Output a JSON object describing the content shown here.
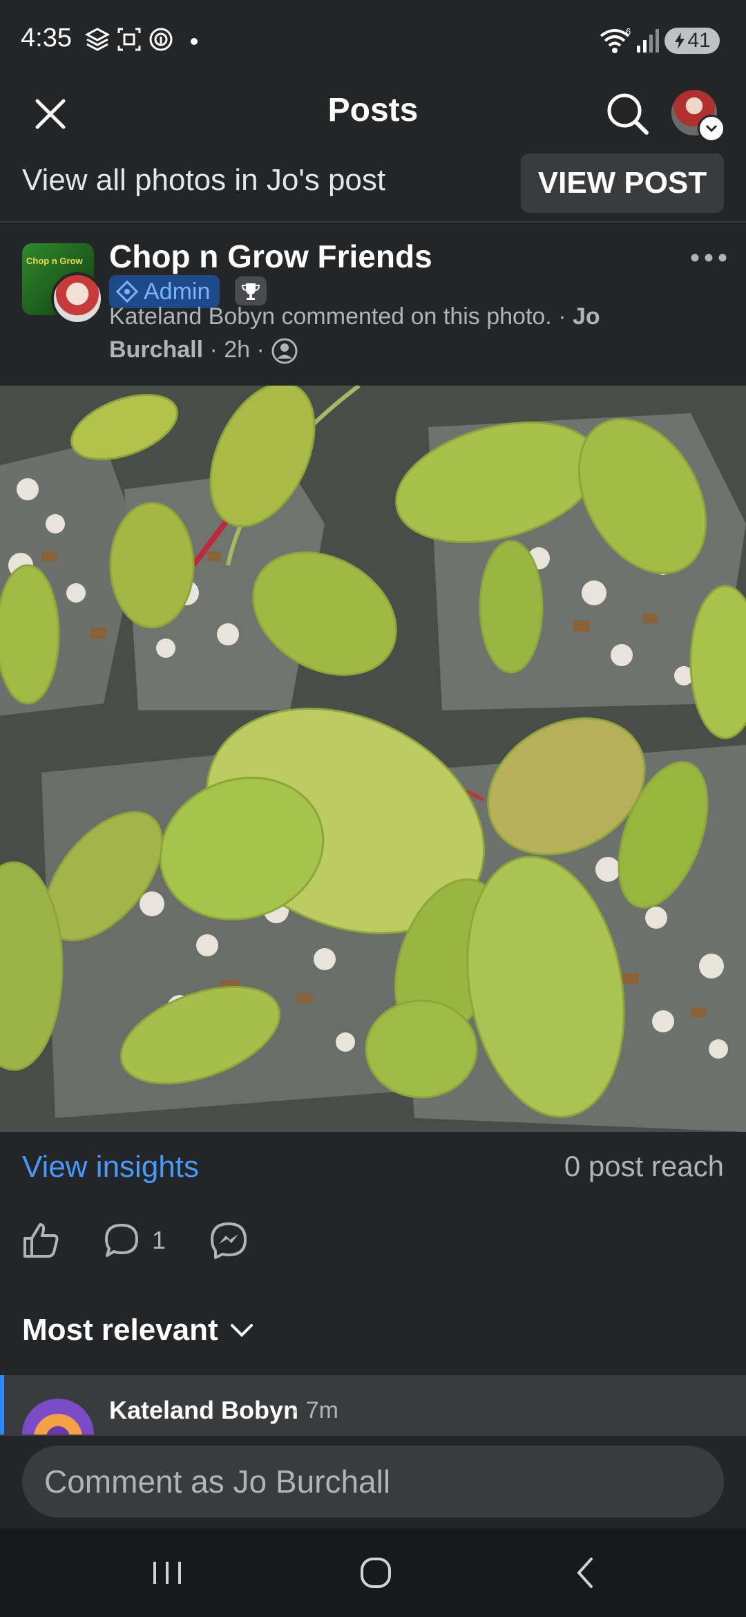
{
  "status_bar": {
    "time": "4:35",
    "battery": "41",
    "icons": [
      "stack-icon",
      "screenshot-icon",
      "nfc-icon",
      "dot-icon",
      "wifi-icon",
      "signal-icon",
      "charging-icon"
    ]
  },
  "header": {
    "title": "Posts",
    "close_icon": "close-icon",
    "search_icon": "search-icon"
  },
  "view_all": {
    "text": "View all photos in Jo's post",
    "button": "VIEW POST"
  },
  "post": {
    "group_name": "Chop n Grow Friends",
    "group_logo_text": "Chop n Grow",
    "admin_label": "Admin",
    "meta_text": "Kateland Bobyn commented on this photo. · ",
    "author": "Jo Burchall",
    "time": " · 2h · "
  },
  "insights": {
    "link": "View insights",
    "reach": "0 post reach"
  },
  "actions": {
    "comment_count": "1"
  },
  "comments": {
    "sort_label": "Most relevant",
    "first": {
      "name": "Kateland Bobyn",
      "time": "· 7m"
    }
  },
  "composer": {
    "placeholder": "Comment as Jo Burchall"
  },
  "colors": {
    "background": "#242526",
    "accent_blue": "#4599ff",
    "surface": "#3a3b3c"
  }
}
